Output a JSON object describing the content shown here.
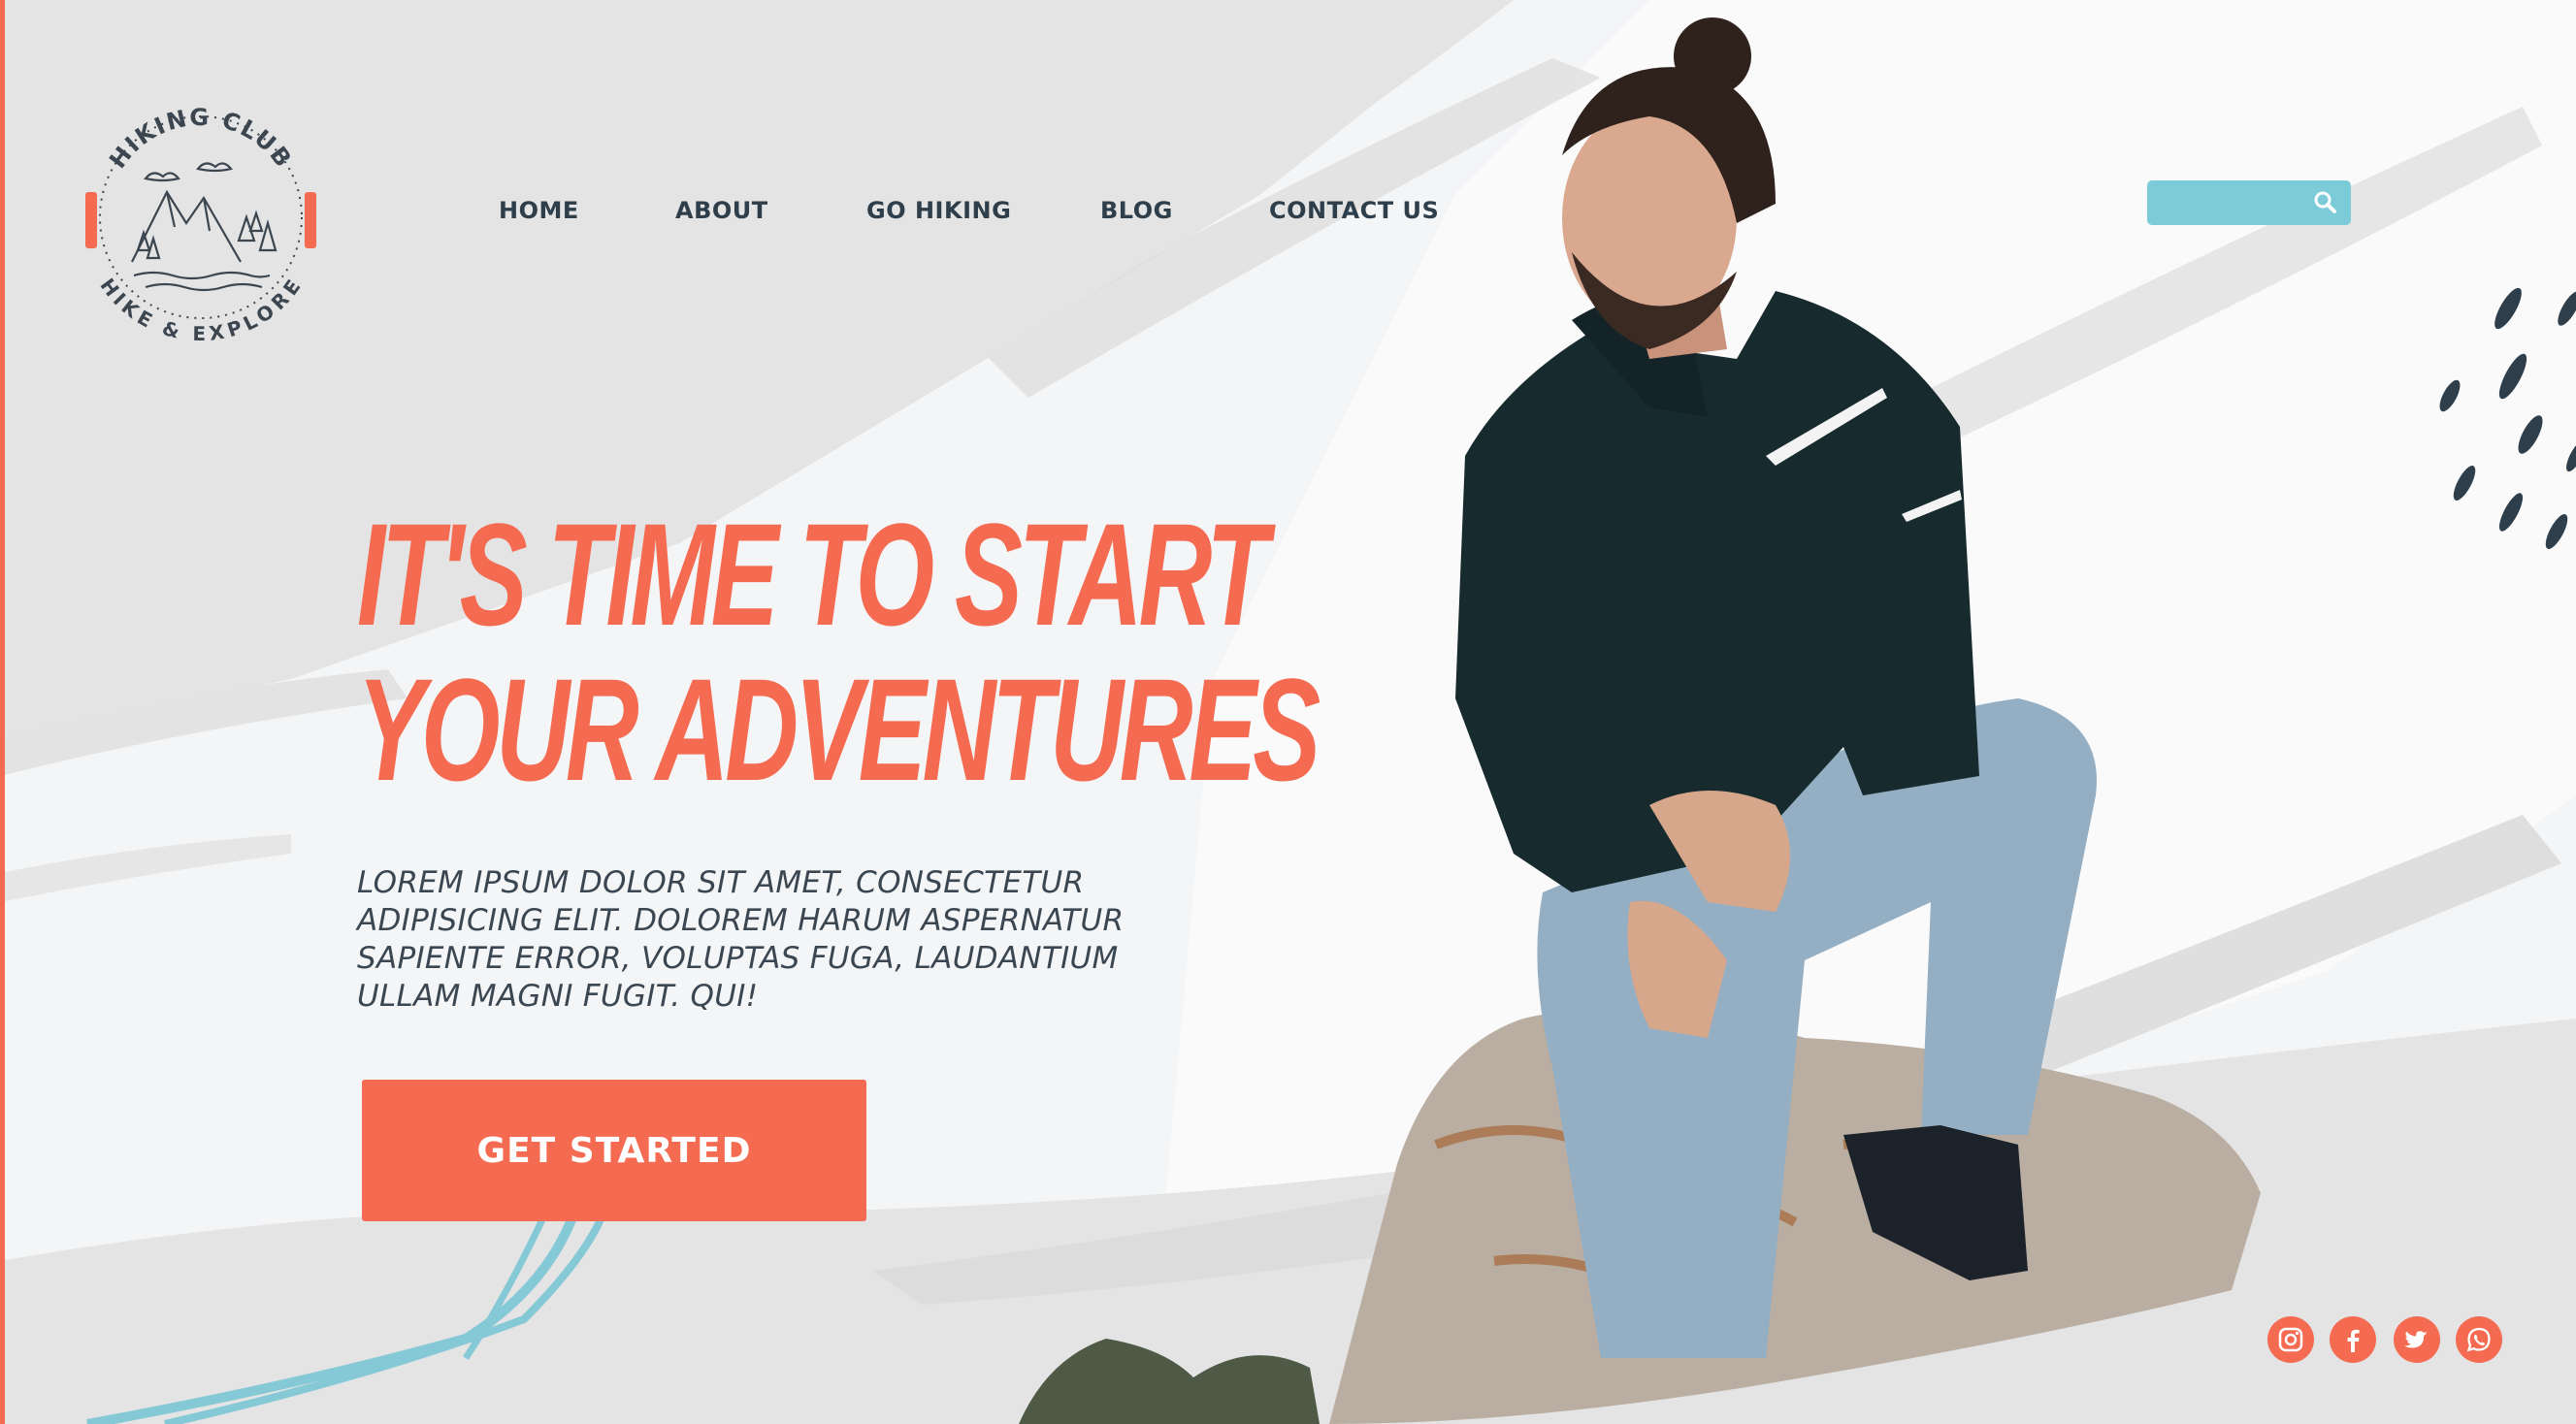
{
  "brand": {
    "name": "HIKING CLUB",
    "tagline": "HIKE & EXPLORE"
  },
  "nav": {
    "items": [
      {
        "label": "HOME"
      },
      {
        "label": "ABOUT"
      },
      {
        "label": "GO HIKING"
      },
      {
        "label": "BLOG"
      },
      {
        "label": "CONTACT US"
      }
    ]
  },
  "search": {
    "placeholder": "",
    "icon": "search-icon"
  },
  "hero": {
    "headline_line1": "IT'S TIME TO START",
    "headline_line2": "YOUR ADVENTURES",
    "body": "LOREM IPSUM DOLOR SIT AMET, CONSECTETUR ADIPISICING ELIT. DOLOREM HARUM ASPERNATUR SAPIENTE ERROR, VOLUPTAS FUGA, LAUDANTIUM ULLAM MAGNI FUGIT. QUI!",
    "cta_label": "GET STARTED"
  },
  "social": [
    {
      "icon": "instagram-icon"
    },
    {
      "icon": "facebook-icon"
    },
    {
      "icon": "twitter-icon"
    },
    {
      "icon": "whatsapp-icon"
    }
  ],
  "colors": {
    "accent": "#f46b52",
    "teal": "#7ccbd8",
    "dark": "#2e3e4a",
    "background": "#e4e4e4"
  }
}
